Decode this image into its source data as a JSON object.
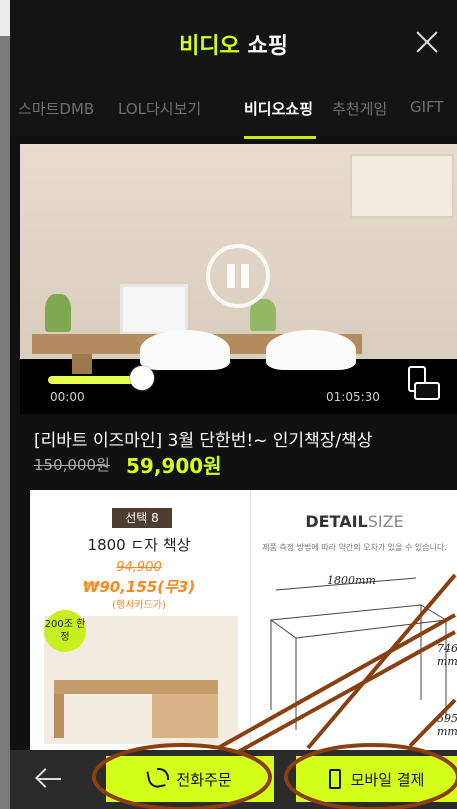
{
  "header": {
    "title_accent": "비디오",
    "title_rest": " 쇼핑",
    "close_icon": "close-icon"
  },
  "tabs": [
    {
      "label": "스마트DMB",
      "active": false
    },
    {
      "label": "LOL다시보기",
      "active": false
    },
    {
      "label": "비디오쇼핑",
      "active": true
    },
    {
      "label": "추천게임",
      "active": false
    },
    {
      "label": "GIFT",
      "active": false
    }
  ],
  "player": {
    "current_time": "00:00",
    "duration": "01:05:30",
    "progress_fraction": 0.28,
    "rotate_icon": "rotate-screen-icon",
    "play_state_icon": "pause-icon"
  },
  "product": {
    "title": "[리바트 이즈마인] 3월 단한번!~ 인기책장/책상",
    "original_price": "150,000원",
    "sale_price": "59,900원"
  },
  "promo": {
    "option_badge": "선택 8",
    "item_name": "1800 ㄷ자 책상",
    "promo_original": "94,900",
    "promo_sale": "₩90,155(무3)",
    "promo_card": "(행사카드가)",
    "sticker": "200조 한정",
    "detail_title_bold": "DETAIL",
    "detail_title_light": "SIZE",
    "detail_note": "제품 측정 방법에 따라 약간의 오차가 있을 수 있습니다.",
    "dim_width": "1800mm",
    "dim_height": "746 mm",
    "dim_depth": "595 mm"
  },
  "bottom": {
    "back_icon": "back-arrow-icon",
    "phone_order_label": "전화주문",
    "mobile_pay_label": "모바일 결제"
  },
  "colors": {
    "accent": "#d4ff1a",
    "annotation_ring": "#8a3f10"
  }
}
